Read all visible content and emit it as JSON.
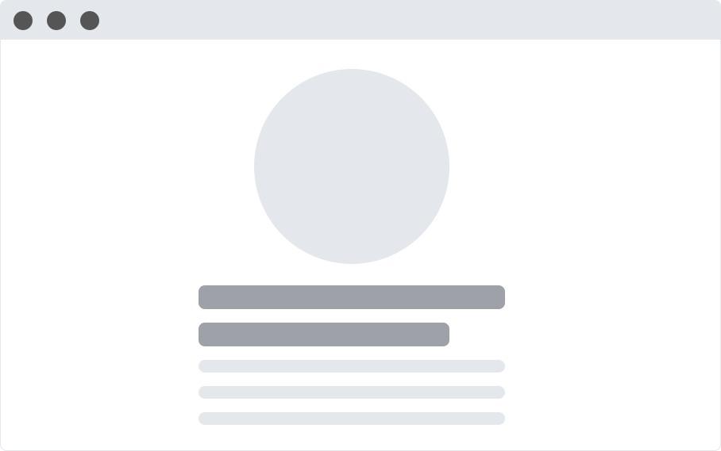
{
  "window": {
    "title_controls": [
      {
        "icon": "window-control-dot-icon"
      },
      {
        "icon": "window-control-dot-icon"
      },
      {
        "icon": "window-control-dot-icon"
      }
    ]
  },
  "skeleton": {
    "avatar_icon": "avatar-placeholder-icon",
    "heading_lines": 2,
    "text_lines": 3
  },
  "colors": {
    "titlebar": "#e4e7eb",
    "window_dot": "#555555",
    "placeholder_light": "#e4e7eb",
    "placeholder_dark": "#9ea1a8"
  }
}
